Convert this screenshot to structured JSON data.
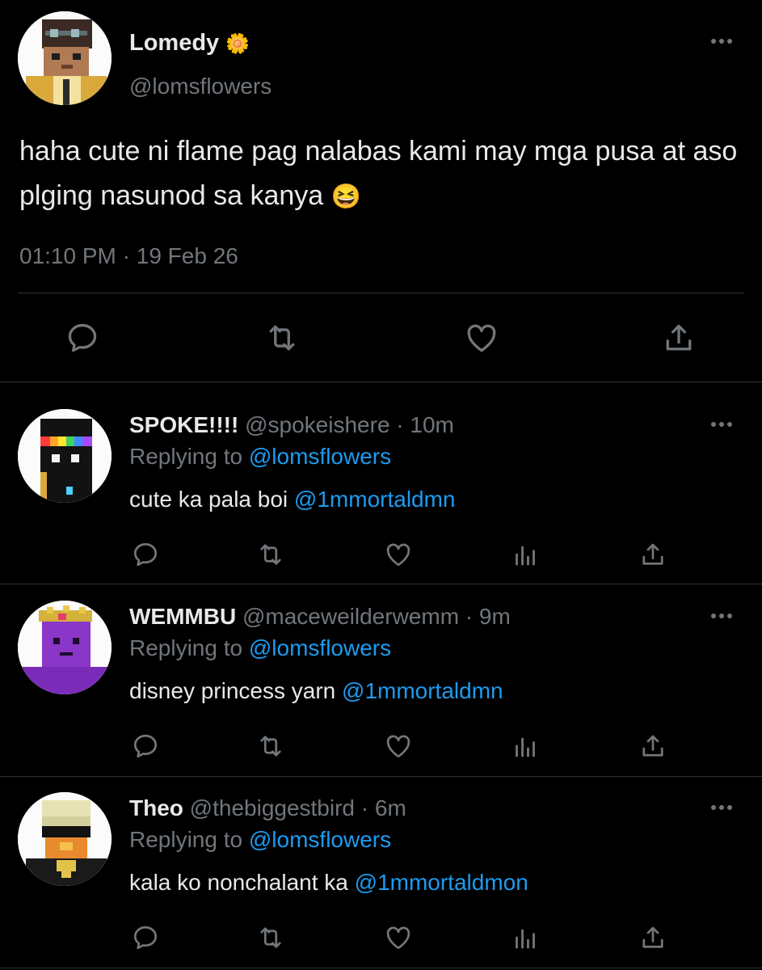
{
  "main_tweet": {
    "name": "Lomedy",
    "name_emoji": "🌼",
    "handle": "@lomsflowers",
    "text": "haha cute ni flame pag nalabas kami may mga pusa at aso plging nasunod sa kanya",
    "text_emoji": "😆",
    "time": "01:10 PM",
    "sep": "·",
    "date": "19 Feb 26"
  },
  "replies": [
    {
      "name": "SPOKE!!!!",
      "handle": "@spokeishere",
      "sep": "·",
      "time": "10m",
      "replying_to_label": "Replying to",
      "replying_to_handle": "@lomsflowers",
      "text": "cute ka pala boi",
      "mention": "@1mmortaldmn"
    },
    {
      "name": "WEMMBU",
      "handle": "@maceweilderwemm",
      "sep": "·",
      "time": "9m",
      "replying_to_label": "Replying to",
      "replying_to_handle": "@lomsflowers",
      "text": "disney princess yarn",
      "mention": "@1mmortaldmn"
    },
    {
      "name": "Theo",
      "handle": "@thebiggestbird",
      "sep": "·",
      "time": "6m",
      "replying_to_label": "Replying to",
      "replying_to_handle": "@lomsflowers",
      "text": "kala ko nonchalant ka",
      "mention": "@1mmortaldmon"
    }
  ],
  "colors": {
    "background": "#000000",
    "text": "#e7e9ea",
    "muted": "#71767b",
    "link": "#1d9bf0",
    "divider": "#2f3336"
  },
  "icons": {
    "more": "more-dots-icon",
    "reply": "reply-bubble-icon",
    "retweet": "retweet-icon",
    "like": "heart-icon",
    "views": "views-bars-icon",
    "share": "share-icon"
  }
}
